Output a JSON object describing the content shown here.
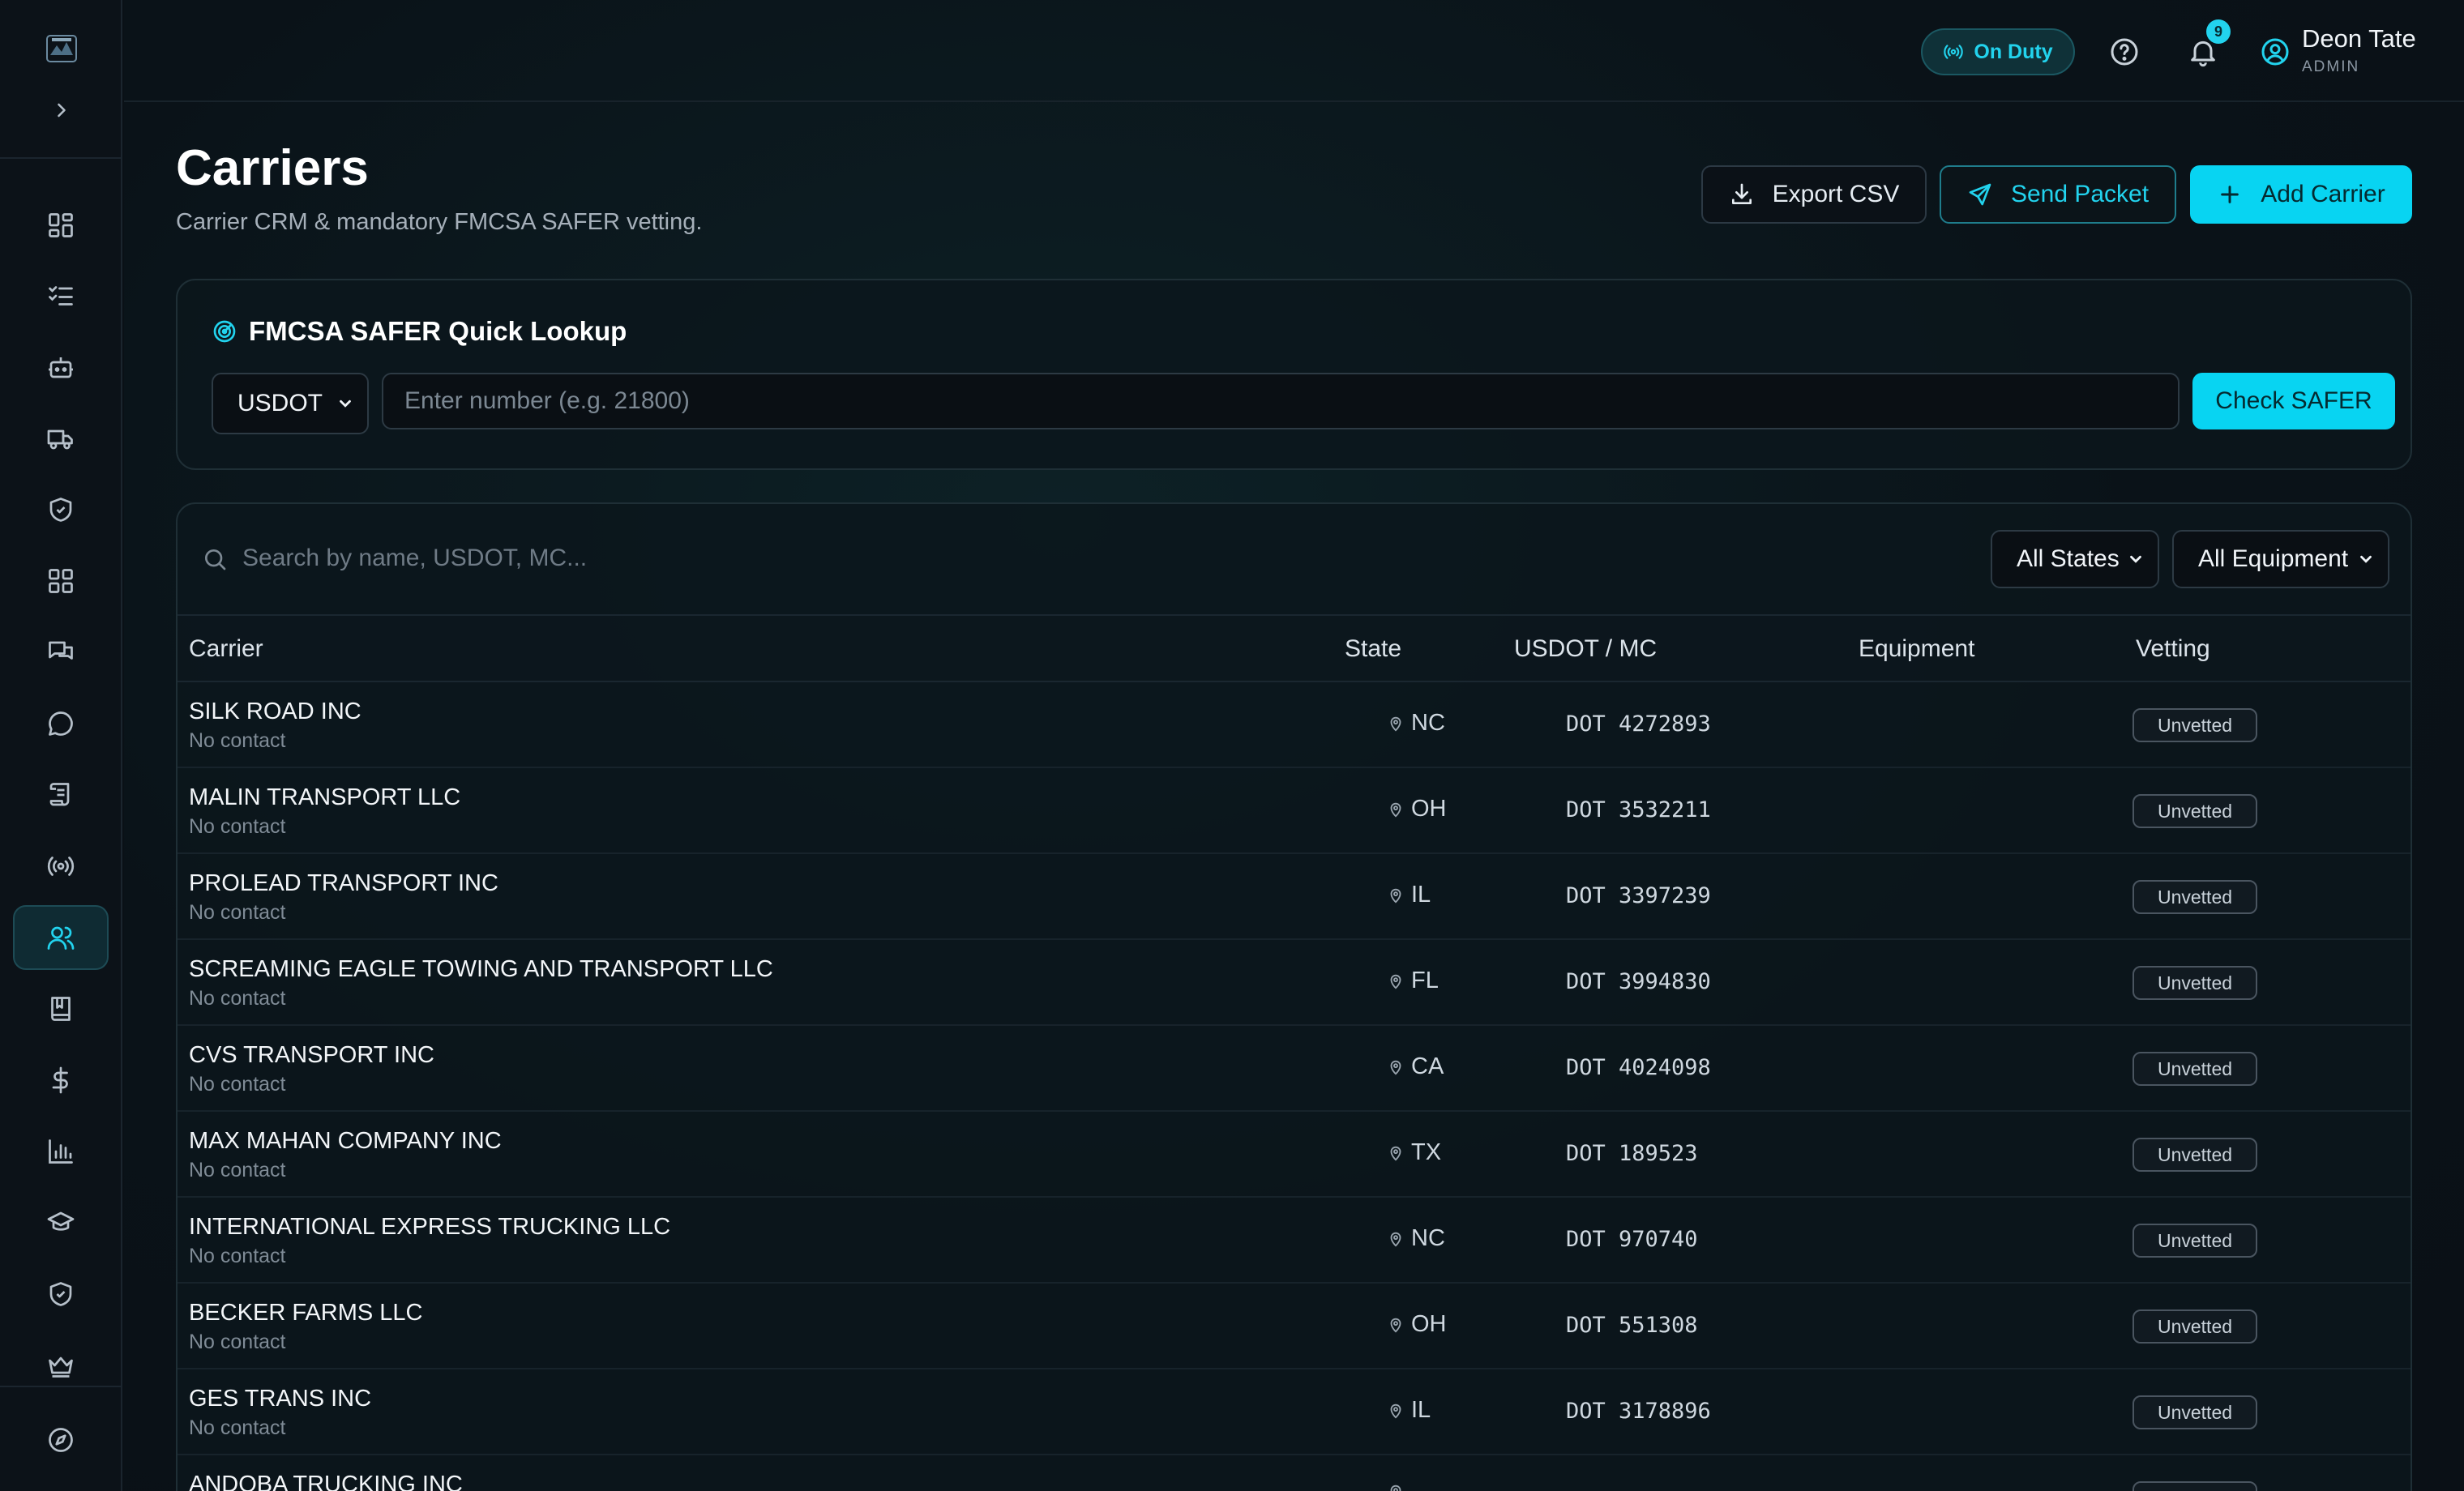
{
  "header": {
    "status_label": "On Duty",
    "notification_count": "9",
    "user_name": "Deon Tate",
    "user_role": "ADMIN"
  },
  "page": {
    "title": "Carriers",
    "subtitle": "Carrier CRM & mandatory FMCSA SAFER vetting."
  },
  "actions": {
    "export_label": "Export CSV",
    "send_label": "Send Packet",
    "add_label": "Add Carrier"
  },
  "lookup": {
    "title": "FMCSA SAFER Quick Lookup",
    "type_value": "USDOT",
    "placeholder": "Enter number (e.g. 21800)",
    "check_label": "Check SAFER"
  },
  "filters": {
    "search_placeholder": "Search by name, USDOT, MC...",
    "states_value": "All States",
    "equipment_value": "All Equipment"
  },
  "table": {
    "columns": [
      "Carrier",
      "State",
      "USDOT / MC",
      "Equipment",
      "Vetting"
    ],
    "rows": [
      {
        "name": "SILK ROAD INC",
        "contact": "No contact",
        "state": "NC",
        "dot": "DOT 4272893",
        "equipment": "",
        "vetting": "Unvetted"
      },
      {
        "name": "MALIN TRANSPORT LLC",
        "contact": "No contact",
        "state": "OH",
        "dot": "DOT 3532211",
        "equipment": "",
        "vetting": "Unvetted"
      },
      {
        "name": "PROLEAD TRANSPORT INC",
        "contact": "No contact",
        "state": "IL",
        "dot": "DOT 3397239",
        "equipment": "",
        "vetting": "Unvetted"
      },
      {
        "name": "SCREAMING EAGLE TOWING AND TRANSPORT LLC",
        "contact": "No contact",
        "state": "FL",
        "dot": "DOT 3994830",
        "equipment": "",
        "vetting": "Unvetted"
      },
      {
        "name": "CVS TRANSPORT INC",
        "contact": "No contact",
        "state": "CA",
        "dot": "DOT 4024098",
        "equipment": "",
        "vetting": "Unvetted"
      },
      {
        "name": "MAX MAHAN COMPANY INC",
        "contact": "No contact",
        "state": "TX",
        "dot": "DOT 189523",
        "equipment": "",
        "vetting": "Unvetted"
      },
      {
        "name": "INTERNATIONAL EXPRESS TRUCKING LLC",
        "contact": "No contact",
        "state": "NC",
        "dot": "DOT 970740",
        "equipment": "",
        "vetting": "Unvetted"
      },
      {
        "name": "BECKER FARMS LLC",
        "contact": "No contact",
        "state": "OH",
        "dot": "DOT 551308",
        "equipment": "",
        "vetting": "Unvetted"
      },
      {
        "name": "GES TRANS INC",
        "contact": "No contact",
        "state": "IL",
        "dot": "DOT 3178896",
        "equipment": "",
        "vetting": "Unvetted"
      },
      {
        "name": "ANDOBA TRUCKING INC",
        "contact": "",
        "state": "",
        "dot": "",
        "equipment": "",
        "vetting": ""
      }
    ]
  },
  "sidebar": {
    "icons": [
      "dashboard-icon",
      "checklist-icon",
      "bot-icon",
      "truck-icon",
      "shield-check-icon",
      "grid-icon",
      "messages-icon",
      "chat-icon",
      "scroll-icon",
      "broadcast-icon",
      "users-icon",
      "book-icon",
      "dollar-icon",
      "bar-chart-icon",
      "graduation-cap-icon",
      "shield-icon",
      "crown-icon",
      "compass-icon"
    ],
    "active": "users-icon"
  },
  "colors": {
    "accent": "#08d4f2",
    "background": "#0a1016",
    "panel_border": "#1f2f36"
  }
}
